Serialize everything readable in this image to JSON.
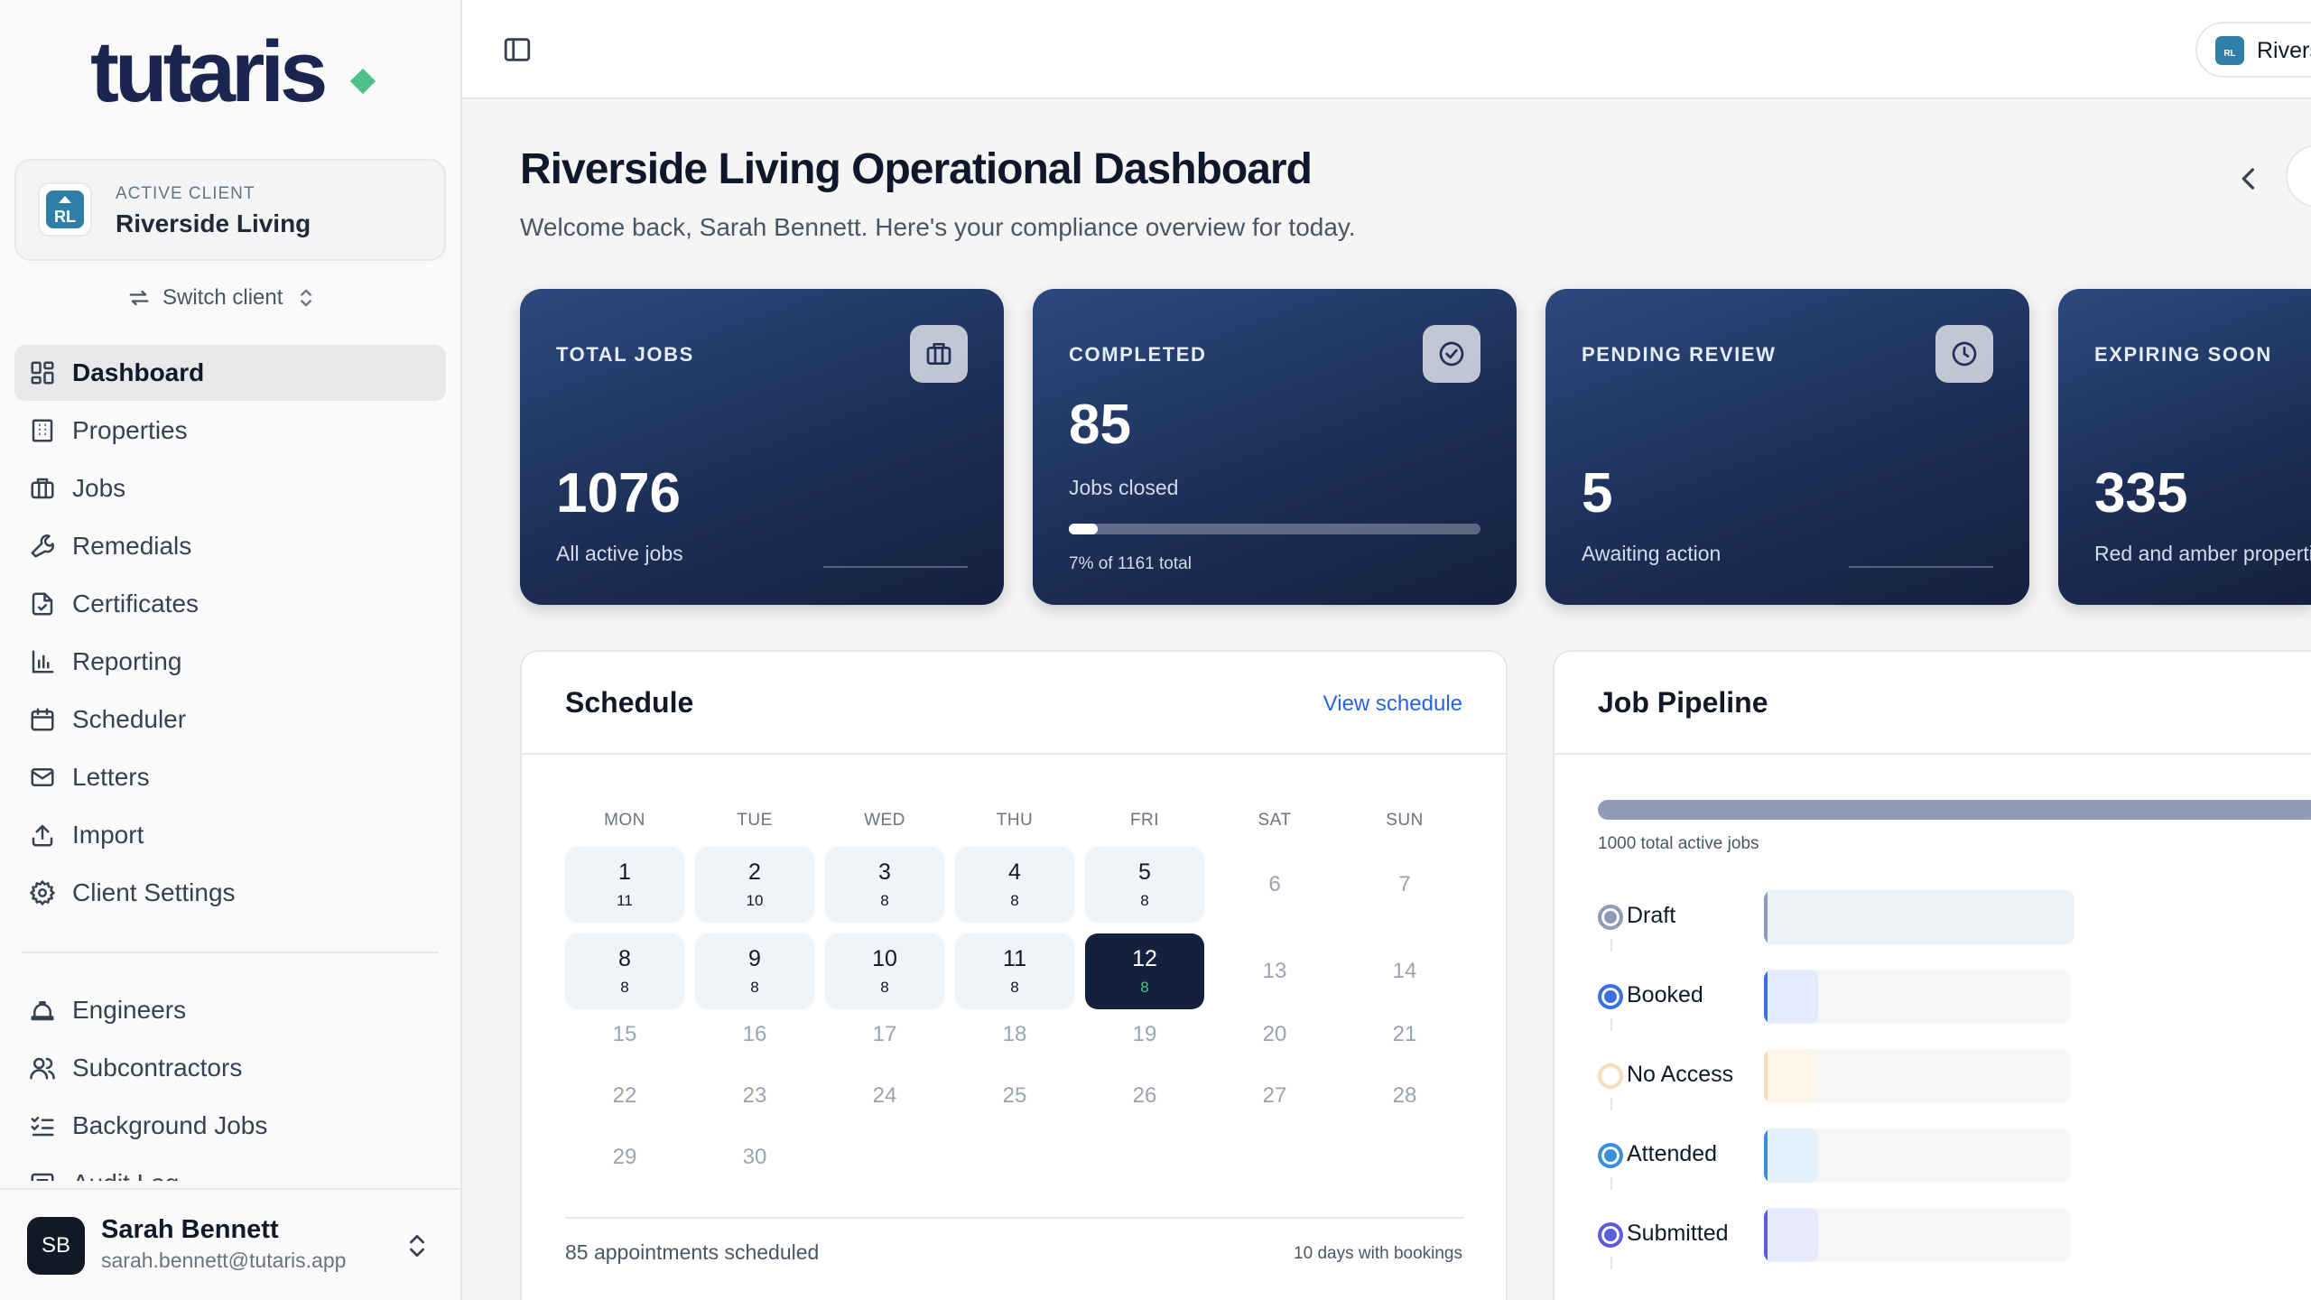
{
  "brand": {
    "name": "tutaris",
    "accent": "#4cc28a"
  },
  "sidebar": {
    "active_client": {
      "kicker": "ACTIVE CLIENT",
      "name": "Riverside Living",
      "initials": "RL"
    },
    "switch_label": "Switch client",
    "nav": [
      {
        "label": "Dashboard",
        "icon": "dashboard-icon",
        "active": true
      },
      {
        "label": "Properties",
        "icon": "building-icon"
      },
      {
        "label": "Jobs",
        "icon": "briefcase-icon"
      },
      {
        "label": "Remedials",
        "icon": "wrench-icon"
      },
      {
        "label": "Certificates",
        "icon": "file-check-icon"
      },
      {
        "label": "Reporting",
        "icon": "bar-chart-icon"
      },
      {
        "label": "Scheduler",
        "icon": "calendar-icon"
      },
      {
        "label": "Letters",
        "icon": "mail-icon"
      },
      {
        "label": "Import",
        "icon": "upload-icon"
      },
      {
        "label": "Client Settings",
        "icon": "gear-icon"
      }
    ],
    "nav_secondary": [
      {
        "label": "Engineers",
        "icon": "hard-hat-icon"
      },
      {
        "label": "Subcontractors",
        "icon": "users-icon"
      },
      {
        "label": "Background Jobs",
        "icon": "list-checks-icon"
      },
      {
        "label": "Audit Log",
        "icon": "log-icon"
      }
    ],
    "user": {
      "initials": "SB",
      "name": "Sarah Bennett",
      "email": "sarah.bennett@tutaris.app"
    }
  },
  "topbar": {
    "client_chip_label": "Riverside Living",
    "client_chip_initials": "RL"
  },
  "header": {
    "title": "Riverside Living Operational Dashboard",
    "subtitle": "Welcome back, Sarah Bennett. Here's your compliance overview for today."
  },
  "stats": [
    {
      "label": "TOTAL JOBS",
      "value": "1076",
      "note": "All active jobs",
      "icon": "briefcase-icon"
    },
    {
      "label": "COMPLETED",
      "value": "85",
      "note": "Jobs closed",
      "progress": 0.07,
      "progress_note": "7% of 1161 total",
      "icon": "check-circle-icon"
    },
    {
      "label": "PENDING REVIEW",
      "value": "5",
      "note": "Awaiting action",
      "icon": "clock-icon"
    },
    {
      "label": "EXPIRING SOON",
      "value": "335",
      "note": "Red and amber properties",
      "icon": "alert-icon"
    }
  ],
  "schedule": {
    "title": "Schedule",
    "link": "View schedule",
    "weekdays": [
      "MON",
      "TUE",
      "WED",
      "THU",
      "FRI",
      "SAT",
      "SUN"
    ],
    "weeks": [
      [
        {
          "day": "1",
          "count": "11"
        },
        {
          "day": "2",
          "count": "10"
        },
        {
          "day": "3",
          "count": "8"
        },
        {
          "day": "4",
          "count": "8"
        },
        {
          "day": "5",
          "count": "8"
        },
        {
          "day": "6"
        },
        {
          "day": "7"
        }
      ],
      [
        {
          "day": "8",
          "count": "8"
        },
        {
          "day": "9",
          "count": "8"
        },
        {
          "day": "10",
          "count": "8"
        },
        {
          "day": "11",
          "count": "8"
        },
        {
          "day": "12",
          "count": "8",
          "today": true
        },
        {
          "day": "13"
        },
        {
          "day": "14"
        }
      ],
      [
        {
          "day": "15"
        },
        {
          "day": "16"
        },
        {
          "day": "17"
        },
        {
          "day": "18"
        },
        {
          "day": "19"
        },
        {
          "day": "20"
        },
        {
          "day": "21"
        }
      ],
      [
        {
          "day": "22"
        },
        {
          "day": "23"
        },
        {
          "day": "24"
        },
        {
          "day": "25"
        },
        {
          "day": "26"
        },
        {
          "day": "27"
        },
        {
          "day": "28"
        }
      ],
      [
        {
          "day": "29"
        },
        {
          "day": "30"
        }
      ]
    ],
    "footer_left": "85 appointments scheduled",
    "footer_right": "10 days with bookings"
  },
  "pipeline": {
    "title": "Job Pipeline",
    "total_note": "1000 total active jobs",
    "stages": [
      {
        "label": "Draft",
        "color": "#8e9cb6",
        "fill": "#eef1f5"
      },
      {
        "label": "Booked",
        "color": "#3b6fe0",
        "fill": "#e3eafb"
      },
      {
        "label": "No Access",
        "color": "#f5dcb8",
        "fill": "#fdf4ea"
      },
      {
        "label": "Attended",
        "color": "#3b8fd6",
        "fill": "#e3f0fa"
      },
      {
        "label": "Submitted",
        "color": "#5a5fd8",
        "fill": "#e8e8fb"
      }
    ]
  }
}
